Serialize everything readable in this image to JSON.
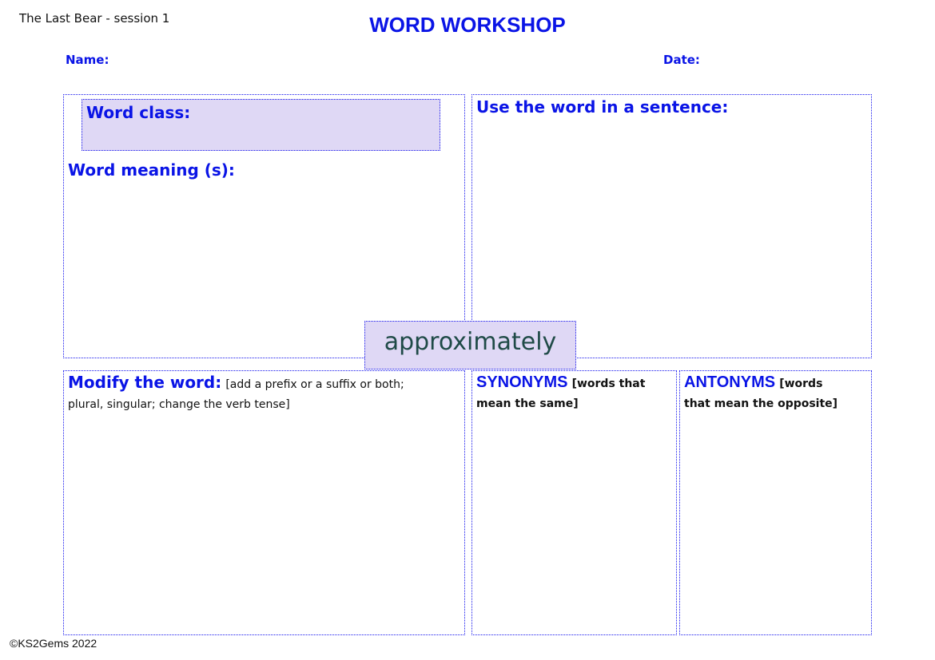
{
  "header": {
    "session": "The Last Bear - session 1",
    "title": "WORD WORKSHOP",
    "name_label": "Name:",
    "date_label": "Date:"
  },
  "sections": {
    "word_class": "Word class:",
    "word_meaning": "Word meaning (s):",
    "sentence": "Use the word in a sentence:",
    "modify_title": "Modify the word:",
    "modify_hint_1": "[add a prefix or a suffix or both;",
    "modify_hint_2": "plural, singular; change the verb tense]",
    "synonyms_title": "SYNONYMS",
    "synonyms_hint_1": "[words that",
    "synonyms_hint_2": "mean the same]",
    "antonyms_title": "ANTONYMS",
    "antonyms_hint_1": "[words",
    "antonyms_hint_2": "that mean the opposite]"
  },
  "word": "approximately",
  "footer": {
    "copyright": "©KS2Gems 2022"
  },
  "colors": {
    "heading_blue": "#0a14e6",
    "box_fill": "#dfd8f5",
    "word_color": "#1f4a47"
  }
}
